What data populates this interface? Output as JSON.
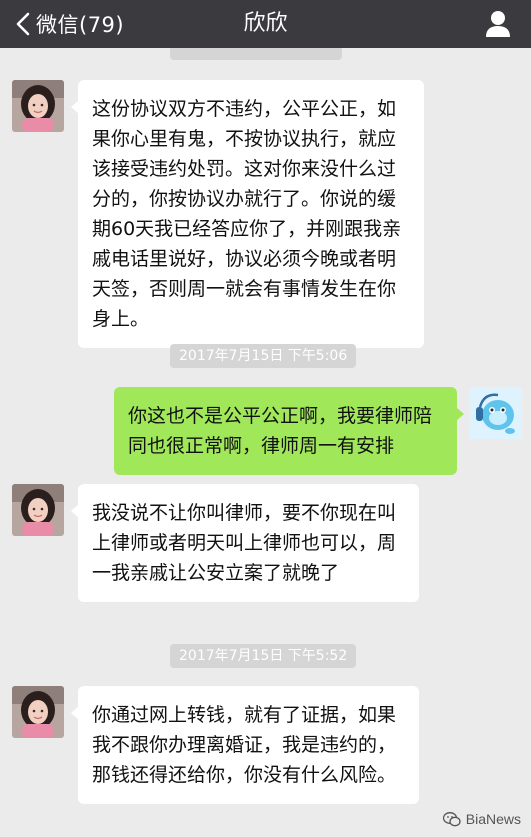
{
  "nav": {
    "back_label": "微信(79)",
    "title": "欣欣"
  },
  "messages": [
    {
      "sender": "欣欣",
      "side": "left",
      "text": "这份协议双方不违约，公平公正，如果你心里有鬼，不按协议执行，就应该接受违约处罚。这对你来没什么过分的，你按协议办就行了。你说的缓期60天我已经答应你了，并刚跟我亲戚电话里说好，协议必须今晚或者明天签，否则周一就会有事情发生在你身上。"
    },
    {
      "timestamp": "2017年7月15日 下午5:06"
    },
    {
      "sender": "me",
      "side": "right",
      "text": "你这也不是公平公正啊，我要律师陪同也很正常啊，律师周一有安排"
    },
    {
      "sender": "欣欣",
      "side": "left",
      "text": "我没说不让你叫律师，要不你现在叫上律师或者明天叫上律师也可以，周一我亲戚让公安立案了就晚了"
    },
    {
      "timestamp": "2017年7月15日 下午5:52"
    },
    {
      "sender": "欣欣",
      "side": "left",
      "text": "你通过网上转钱，就有了证据，如果我不跟你办理离婚证，我是违约的，那钱还得还给你，你没有什么风险。"
    }
  ],
  "watermark": "BiaNews",
  "colors": {
    "nav_bg": "#3a3a3f",
    "chat_bg": "#ebebeb",
    "bubble_left": "#ffffff",
    "bubble_right": "#a0e75a",
    "timestamp_bg": "#d5d5d5"
  }
}
